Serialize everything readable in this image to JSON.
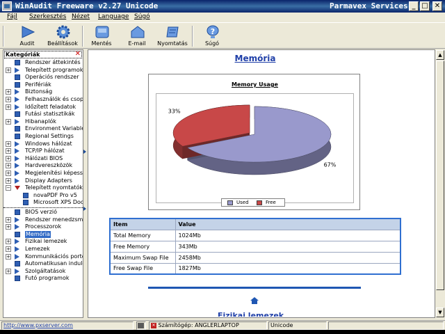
{
  "window": {
    "title": "WinAudit Freeware v2.27 Unicode",
    "vendor": "Parmavex Services"
  },
  "window_buttons": {
    "minimize": "_",
    "maximize": "□",
    "close": "✕"
  },
  "menu": [
    "Fájl",
    "Szerkesztés",
    "Nézet",
    "Language",
    "Súgó"
  ],
  "toolbar": [
    {
      "label": "Audit",
      "icon": "play-icon"
    },
    {
      "label": "Beállítások",
      "icon": "gear-icon"
    },
    {
      "label": "Mentés",
      "icon": "save-icon"
    },
    {
      "label": "E-mail",
      "icon": "email-icon"
    },
    {
      "label": "Nyomtatás",
      "icon": "print-icon"
    },
    {
      "label": "Súgó",
      "icon": "help-icon"
    }
  ],
  "sidebar": {
    "header": "Kategóriák",
    "close_glyph": "✕",
    "items": [
      {
        "label": "Rendszer áttekintés",
        "expander": "",
        "icon": "square"
      },
      {
        "label": "Telepített programok",
        "expander": "+",
        "icon": "arrow"
      },
      {
        "label": "Operációs rendszer",
        "expander": "",
        "icon": "square"
      },
      {
        "label": "Perifériák",
        "expander": "",
        "icon": "square"
      },
      {
        "label": "Biztonság",
        "expander": "+",
        "icon": "arrow"
      },
      {
        "label": "Felhasználók és csoportok",
        "expander": "+",
        "icon": "arrow"
      },
      {
        "label": "Időzített feladatok",
        "expander": "+",
        "icon": "arrow"
      },
      {
        "label": "Futási statisztikák",
        "expander": "",
        "icon": "square"
      },
      {
        "label": "Hibanaplók",
        "expander": "+",
        "icon": "arrow"
      },
      {
        "label": "Environment Variables",
        "expander": "",
        "icon": "square"
      },
      {
        "label": "Regional Settings",
        "expander": "",
        "icon": "square"
      },
      {
        "label": "Windows hálózat",
        "expander": "+",
        "icon": "arrow"
      },
      {
        "label": "TCP/IP hálózat",
        "expander": "+",
        "icon": "arrow"
      },
      {
        "label": "Hálózati BIOS",
        "expander": "+",
        "icon": "arrow"
      },
      {
        "label": "Hardvereszközök",
        "expander": "+",
        "icon": "arrow"
      },
      {
        "label": "Megjelenítési képességek",
        "expander": "+",
        "icon": "arrow"
      },
      {
        "label": "Display Adapters",
        "expander": "+",
        "icon": "arrow"
      },
      {
        "label": "Telepített nyomtatók",
        "expander": "−",
        "icon": "arrow-down"
      },
      {
        "label": "novaPDF Pro v5",
        "expander": "",
        "icon": "square",
        "indent": true
      },
      {
        "label": "Microsoft XPS Document Writer",
        "expander": "",
        "icon": "square",
        "indent": true
      },
      {
        "label": "BIOS verzió",
        "expander": "",
        "icon": "square"
      },
      {
        "label": "Rendszer menedzsment",
        "expander": "+",
        "icon": "arrow"
      },
      {
        "label": "Processzorok",
        "expander": "+",
        "icon": "arrow"
      },
      {
        "label": "Memória",
        "expander": "",
        "icon": "square",
        "selected": true
      },
      {
        "label": "Fizikai lemezek",
        "expander": "+",
        "icon": "arrow"
      },
      {
        "label": "Lemezek",
        "expander": "+",
        "icon": "arrow"
      },
      {
        "label": "Kommunikációs portok",
        "expander": "+",
        "icon": "arrow"
      },
      {
        "label": "Automatikusan induló programok",
        "expander": "",
        "icon": "square"
      },
      {
        "label": "Szolgáltatások",
        "expander": "+",
        "icon": "arrow"
      },
      {
        "label": "Futó programok",
        "expander": "",
        "icon": "square"
      }
    ]
  },
  "content": {
    "page_title": "Memória",
    "home_icon": "home-icon",
    "partial_heading": "Fizikai lemezek",
    "table": {
      "headers": [
        "Item",
        "Value"
      ],
      "rows": [
        [
          "Total Memory",
          "1024Mb"
        ],
        [
          "Free Memory",
          "343Mb"
        ],
        [
          "Maximum Swap File",
          "2458Mb"
        ],
        [
          "Free Swap File",
          "1827Mb"
        ]
      ]
    }
  },
  "chart_data": {
    "type": "pie",
    "title": "Memory Usage",
    "slices": [
      {
        "name": "Used",
        "value": 67,
        "label": "67%",
        "color": "#9999cc"
      },
      {
        "name": "Free",
        "value": 33,
        "label": "33%",
        "color": "#c84848"
      }
    ],
    "legend_placement": "bottom"
  },
  "statusbar": {
    "url": "http://www.pxserver.com",
    "computer": "Számítógép: ANGLERLAPTOP",
    "encoding": "Unicode"
  },
  "colors": {
    "accent": "#316ac5",
    "title_link": "#1f3fa8",
    "table_border": "#2f6fd0"
  }
}
